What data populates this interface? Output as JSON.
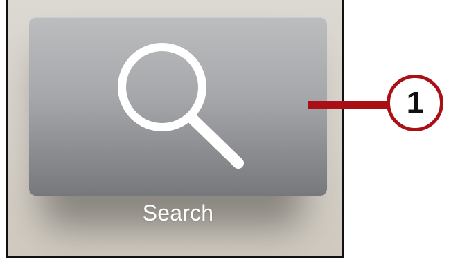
{
  "app_tile": {
    "label": "Search",
    "icon": "search-icon",
    "colors": {
      "tile_top": "#bcbdbf",
      "tile_bottom": "#76787b",
      "icon": "#ffffff",
      "label": "#ffffff"
    }
  },
  "callout": {
    "number": "1",
    "color": "#a90f14"
  }
}
